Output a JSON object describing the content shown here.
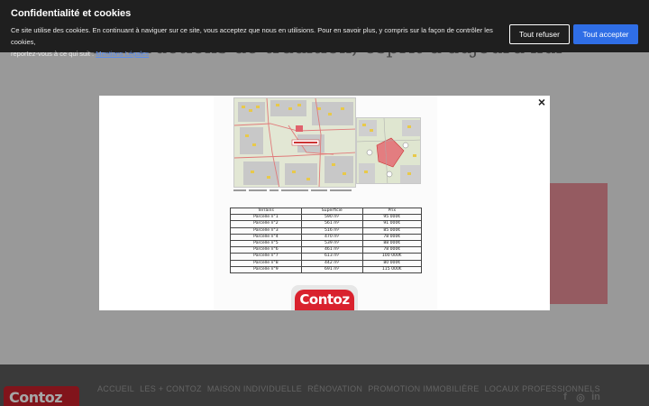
{
  "page": {
    "hero_title": "Constructions de tradition, esprit d'aujourd'hui"
  },
  "cookie_banner": {
    "title": "Confidentialité et cookies",
    "text_line1": "Ce site utilise des cookies. En continuant à naviguer sur ce site, vous acceptez que nous en utilisions. Pour en savoir plus, y compris sur la façon de contrôler les cookies,",
    "text_line2": "reportez-vous à ce qui suit :",
    "link_label": "Mentions Légales",
    "refuse_label": "Tout refuser",
    "accept_label": "Tout accepter",
    "accept_color": "#2f6ee6"
  },
  "modal": {
    "close_label": "×",
    "table": {
      "headers": [
        "Terrains",
        "Superficie",
        "Prix"
      ],
      "rows": [
        [
          "Parcelle n°1",
          "590 m²",
          "95 000€"
        ],
        [
          "Parcelle n°2",
          "561 m²",
          "91 000€"
        ],
        [
          "Parcelle n°3",
          "516 m²",
          "85 000€"
        ],
        [
          "Parcelle n°4",
          "470 m²",
          "78 000€"
        ],
        [
          "Parcelle n°5",
          "539 m²",
          "88 000€"
        ],
        [
          "Parcelle n°6",
          "461 m²",
          "78 000€"
        ],
        [
          "Parcelle n°7",
          "613 m²",
          "100 000€"
        ],
        [
          "Parcelle n°8",
          "442 m²",
          "80 000€"
        ],
        [
          "Parcelle n°9",
          "691 m²",
          "115 000€"
        ]
      ]
    },
    "logo_text": "Contoz"
  },
  "footer": {
    "logo_text": "Contoz",
    "nav": [
      "ACCUEIL",
      "LES + CONTOZ",
      "MAISON INDIVIDUELLE",
      "RÉNOVATION",
      "PROMOTION IMMOBILIÈRE",
      "LOCAUX PROFESSIONNELS"
    ],
    "social": [
      "f",
      "◎",
      "in"
    ]
  },
  "colors": {
    "brand_red": "#d9222e",
    "card_pink": "#e58d95",
    "banner_bg": "#1f1f1f"
  }
}
